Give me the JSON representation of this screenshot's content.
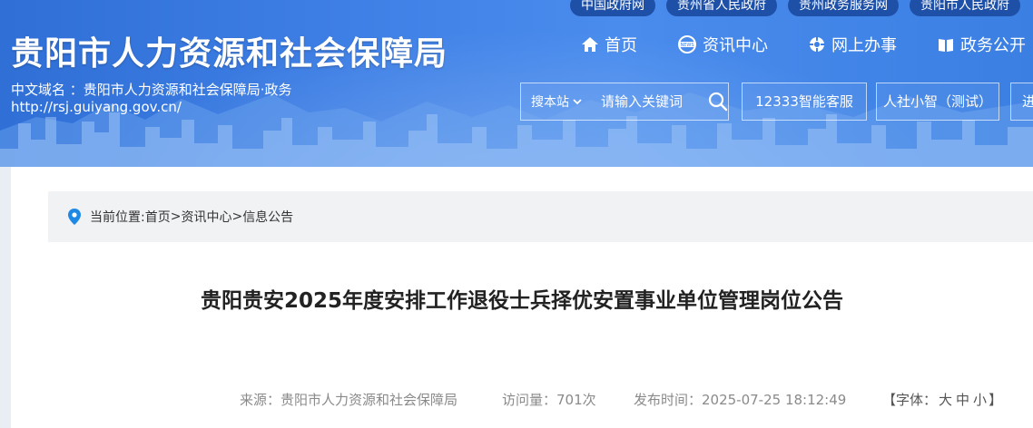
{
  "top_links": [
    "中国政府网",
    "贵州省人民政府",
    "贵州政务服务网",
    "贵阳市人民政府"
  ],
  "header": {
    "site_title": "贵阳市人力资源和社会保障局",
    "domain_cn": "中文域名 ：贵阳市人力资源和社会保障局·政务",
    "domain_url": "http://rsj.guiyang.gov.cn/"
  },
  "nav": [
    {
      "label": "首页",
      "icon": "home-icon"
    },
    {
      "label": "资讯中心",
      "icon": "news-icon"
    },
    {
      "label": "网上办事",
      "icon": "service-icon"
    },
    {
      "label": "政务公开",
      "icon": "book-icon"
    }
  ],
  "search": {
    "scope_label": "搜本站",
    "placeholder": "请输入关键词"
  },
  "quick_buttons": [
    "12333智能客服",
    "人社小智（测试）",
    "进"
  ],
  "breadcrumb": {
    "prefix": "当前位置: ",
    "items": [
      "首页",
      "资讯中心",
      "信息公告"
    ],
    "separator": ">"
  },
  "article": {
    "title": "贵阳贵安2025年度安排工作退役士兵择优安置事业单位管理岗位公告",
    "source": "来源：贵阳市人力资源和社会保障局",
    "views": "访问量：701次",
    "publish_time": "发布时间：2025-07-25 18:12:49",
    "font_label": "【字体：",
    "font_sizes": [
      "大",
      "中",
      "小"
    ],
    "font_close": "】"
  },
  "colors": {
    "banner_blue": "#3f80e6",
    "toplink_bg": "#1e50a8",
    "title_text": "#222222"
  }
}
